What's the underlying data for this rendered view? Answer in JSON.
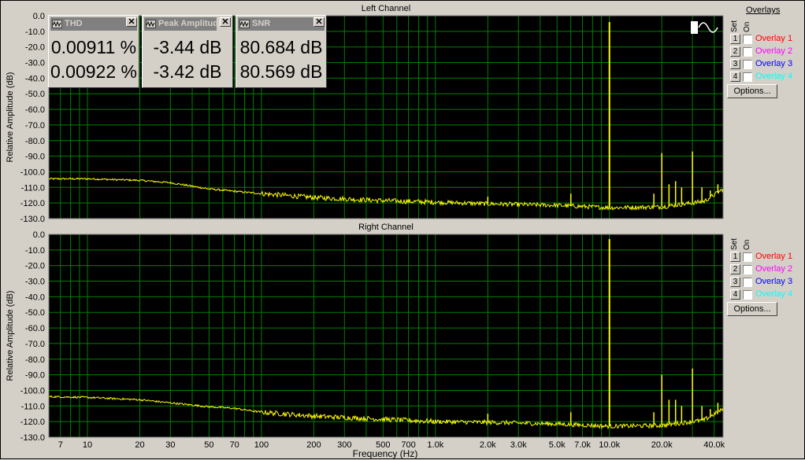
{
  "meters": [
    {
      "title": "THD",
      "values": [
        "0.00911 %",
        "0.00922 %"
      ],
      "icon": "waveform-icon"
    },
    {
      "title": "Peak Amplitude",
      "values": [
        "-3.44 dB",
        "-3.42 dB"
      ],
      "icon": "waveform-icon"
    },
    {
      "title": "SNR",
      "values": [
        "80.684 dB",
        "80.569 dB"
      ],
      "icon": "waveform-icon"
    }
  ],
  "overlays": {
    "title": "Overlays",
    "set_label": "Set",
    "on_label": "On",
    "options_label": "Options...",
    "items": [
      {
        "num": "1",
        "label": "Overlay 1",
        "color": "#ff0000"
      },
      {
        "num": "2",
        "label": "Overlay 2",
        "color": "#ff00ff"
      },
      {
        "num": "3",
        "label": "Overlay 3",
        "color": "#0000ff"
      },
      {
        "num": "4",
        "label": "Overlay 4",
        "color": "#00ffff"
      }
    ]
  },
  "xlabel": "Frequency (Hz)",
  "colors": {
    "trace": "#ffff00",
    "grid": "#008000",
    "plot_bg": "#000000"
  },
  "chart_data": [
    {
      "type": "line",
      "title": "Left Channel",
      "xlabel": "Frequency (Hz)",
      "ylabel": "Relative Amplitude (dB)",
      "xscale": "log",
      "xlim": [
        6,
        45000
      ],
      "ylim": [
        -130,
        0
      ],
      "x_ticks": [
        7,
        10,
        20,
        30,
        50,
        70,
        100,
        200,
        300,
        500,
        700,
        1000,
        2000,
        3000,
        5000,
        7000,
        10000,
        20000,
        40000
      ],
      "x_tick_labels": [
        "7",
        "10",
        "20",
        "30",
        "50",
        "70",
        "100",
        "200",
        "300",
        "500",
        "700",
        "1.0k",
        "2.0k",
        "3.0k",
        "5.0k",
        "7.0k",
        "10.0k",
        "20.0k",
        "40.0k"
      ],
      "y_ticks": [
        0,
        -10,
        -20,
        -30,
        -40,
        -50,
        -60,
        -70,
        -80,
        -90,
        -100,
        -110,
        -120,
        -130
      ],
      "y_tick_labels": [
        "0.0",
        "-10.0",
        "-20.0",
        "-30.0",
        "-40.0",
        "-50.0",
        "-60.0",
        "-70.0",
        "-80.0",
        "-90.0",
        "-100.0",
        "-110.0",
        "-120.0",
        "-130.0"
      ],
      "grid": true,
      "noise_floor": {
        "x": [
          6,
          10,
          20,
          30,
          50,
          70,
          100,
          200,
          500,
          1000,
          2000,
          5000,
          10000,
          20000,
          35000,
          45000
        ],
        "y": [
          -104.5,
          -104.5,
          -105.5,
          -107,
          -111,
          -112.5,
          -114,
          -116.5,
          -118.5,
          -119.5,
          -120.5,
          -121.5,
          -123,
          -122.5,
          -119,
          -111
        ]
      },
      "spikes": {
        "x": [
          1000,
          2000,
          6000,
          10000,
          18000,
          20000,
          22000,
          24000,
          26000,
          30000,
          34000,
          38000,
          42000
        ],
        "y": [
          -119,
          -116,
          -114,
          -4,
          -114,
          -88,
          -108,
          -106,
          -110,
          -87,
          -110,
          -112,
          -108
        ]
      }
    },
    {
      "type": "line",
      "title": "Right Channel",
      "xlabel": "Frequency (Hz)",
      "ylabel": "Relative Amplitude (dB)",
      "xscale": "log",
      "xlim": [
        6,
        45000
      ],
      "ylim": [
        -130,
        0
      ],
      "x_ticks": [
        7,
        10,
        20,
        30,
        50,
        70,
        100,
        200,
        300,
        500,
        700,
        1000,
        2000,
        3000,
        5000,
        7000,
        10000,
        20000,
        40000
      ],
      "x_tick_labels": [
        "7",
        "10",
        "20",
        "30",
        "50",
        "70",
        "100",
        "200",
        "300",
        "500",
        "700",
        "1.0k",
        "2.0k",
        "3.0k",
        "5.0k",
        "7.0k",
        "10.0k",
        "20.0k",
        "40.0k"
      ],
      "y_ticks": [
        0,
        -10,
        -20,
        -30,
        -40,
        -50,
        -60,
        -70,
        -80,
        -90,
        -100,
        -110,
        -120,
        -130
      ],
      "y_tick_labels": [
        "0.0",
        "-10.0",
        "-20.0",
        "-30.0",
        "-40.0",
        "-50.0",
        "-60.0",
        "-70.0",
        "-80.0",
        "-90.0",
        "-100.0",
        "-110.0",
        "-120.0",
        "-130.0"
      ],
      "grid": true,
      "noise_floor": {
        "x": [
          6,
          10,
          20,
          30,
          50,
          70,
          100,
          200,
          500,
          1000,
          2000,
          5000,
          10000,
          20000,
          35000,
          45000
        ],
        "y": [
          -104,
          -104.5,
          -106,
          -108,
          -110.5,
          -111.5,
          -114,
          -116.5,
          -118.5,
          -120,
          -120.5,
          -121.5,
          -123,
          -122.5,
          -119,
          -112
        ]
      },
      "spikes": {
        "x": [
          1000,
          2000,
          6000,
          10000,
          18000,
          20000,
          22000,
          24000,
          26000,
          30000,
          34000,
          38000,
          42000
        ],
        "y": [
          -119,
          -115,
          -114,
          -3,
          -114,
          -90,
          -106,
          -106,
          -110,
          -86,
          -110,
          -112,
          -108
        ]
      }
    }
  ]
}
